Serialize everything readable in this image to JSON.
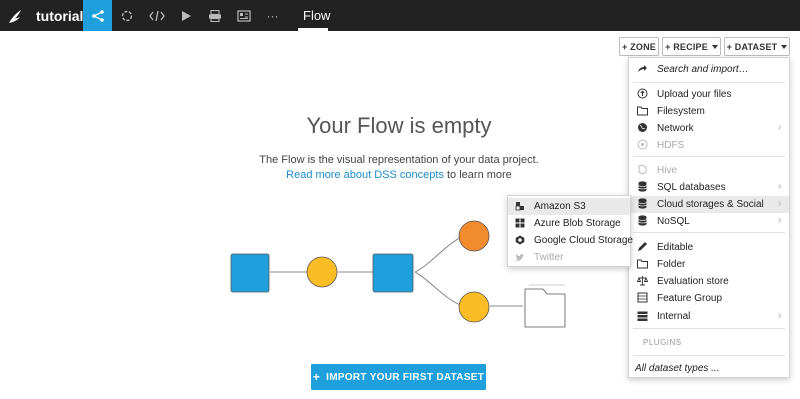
{
  "topbar": {
    "project_name": "tutorial",
    "active_view": "Flow",
    "nav_icons": [
      "flow-icon",
      "lab-icon",
      "code-icon",
      "run-icon",
      "jobs-icon",
      "dashboard-icon",
      "more-icon"
    ],
    "more_label": "···"
  },
  "toolbar": {
    "zone_label": "+ ZONE",
    "recipe_label": "+ RECIPE",
    "dataset_label": "+ DATASET"
  },
  "empty_state": {
    "title": "Your Flow is empty",
    "description": "The Flow is the visual representation of your data project.",
    "link_text": "Read more about DSS concepts",
    "link_suffix": " to learn more",
    "import_label": "IMPORT YOUR FIRST DATASET",
    "import_plus": "+"
  },
  "dataset_menu": {
    "search": "Search and import…",
    "items": [
      {
        "label": "Upload your files",
        "icon": "upload-icon"
      },
      {
        "label": "Filesystem",
        "icon": "folder-outline-icon"
      },
      {
        "label": "Network",
        "icon": "globe-icon"
      },
      {
        "label": "HDFS",
        "icon": "hdfs-icon"
      },
      {
        "label": "Hive",
        "icon": "hive-icon"
      },
      {
        "label": "SQL databases",
        "icon": "database-icon"
      },
      {
        "label": "Cloud storages & Social",
        "icon": "cloud-database-icon"
      },
      {
        "label": "NoSQL",
        "icon": "nosql-database-icon"
      },
      {
        "label": "Editable",
        "icon": "pencil-icon"
      },
      {
        "label": "Folder",
        "icon": "folder-icon"
      },
      {
        "label": "Evaluation store",
        "icon": "balance-icon"
      },
      {
        "label": "Feature Group",
        "icon": "feature-group-icon"
      },
      {
        "label": "Internal",
        "icon": "internal-icon"
      }
    ],
    "plugins_label": "PLUGINS",
    "all_types": "All dataset types ..."
  },
  "cloud_submenu": {
    "items": [
      {
        "label": "Amazon S3",
        "icon": "amazon-s3-icon"
      },
      {
        "label": "Azure Blob Storage",
        "icon": "windows-icon"
      },
      {
        "label": "Google Cloud Storage",
        "icon": "google-cloud-icon"
      },
      {
        "label": "Twitter",
        "icon": "twitter-icon"
      }
    ]
  },
  "colors": {
    "topbar": "#222222",
    "accent": "#1fa0dc",
    "dataset_node": "#1fa0dc",
    "recipe_node": "#fcbc26",
    "recipe_node_alt": "#f28b2d"
  }
}
